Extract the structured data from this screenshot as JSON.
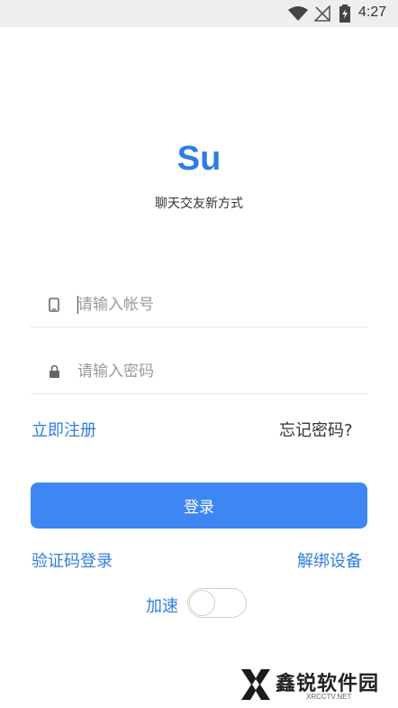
{
  "status_bar": {
    "time": "4:27"
  },
  "app": {
    "logo": "Su",
    "tagline": "聊天交友新方式"
  },
  "form": {
    "account_placeholder": "请输入帐号",
    "password_placeholder": "请输入密码"
  },
  "links": {
    "register": "立即注册",
    "forgot_password": "忘记密码?",
    "sms_login": "验证码登录",
    "unbind_device": "解绑设备"
  },
  "login_button": "登录",
  "speed": {
    "label": "加速",
    "enabled": false
  },
  "watermark": {
    "text": "鑫锐软件园",
    "sub": "XRCCTV.NET"
  },
  "colors": {
    "accent": "#2f7de1",
    "button": "#3f86f5",
    "status_bg": "#eeeeee"
  }
}
